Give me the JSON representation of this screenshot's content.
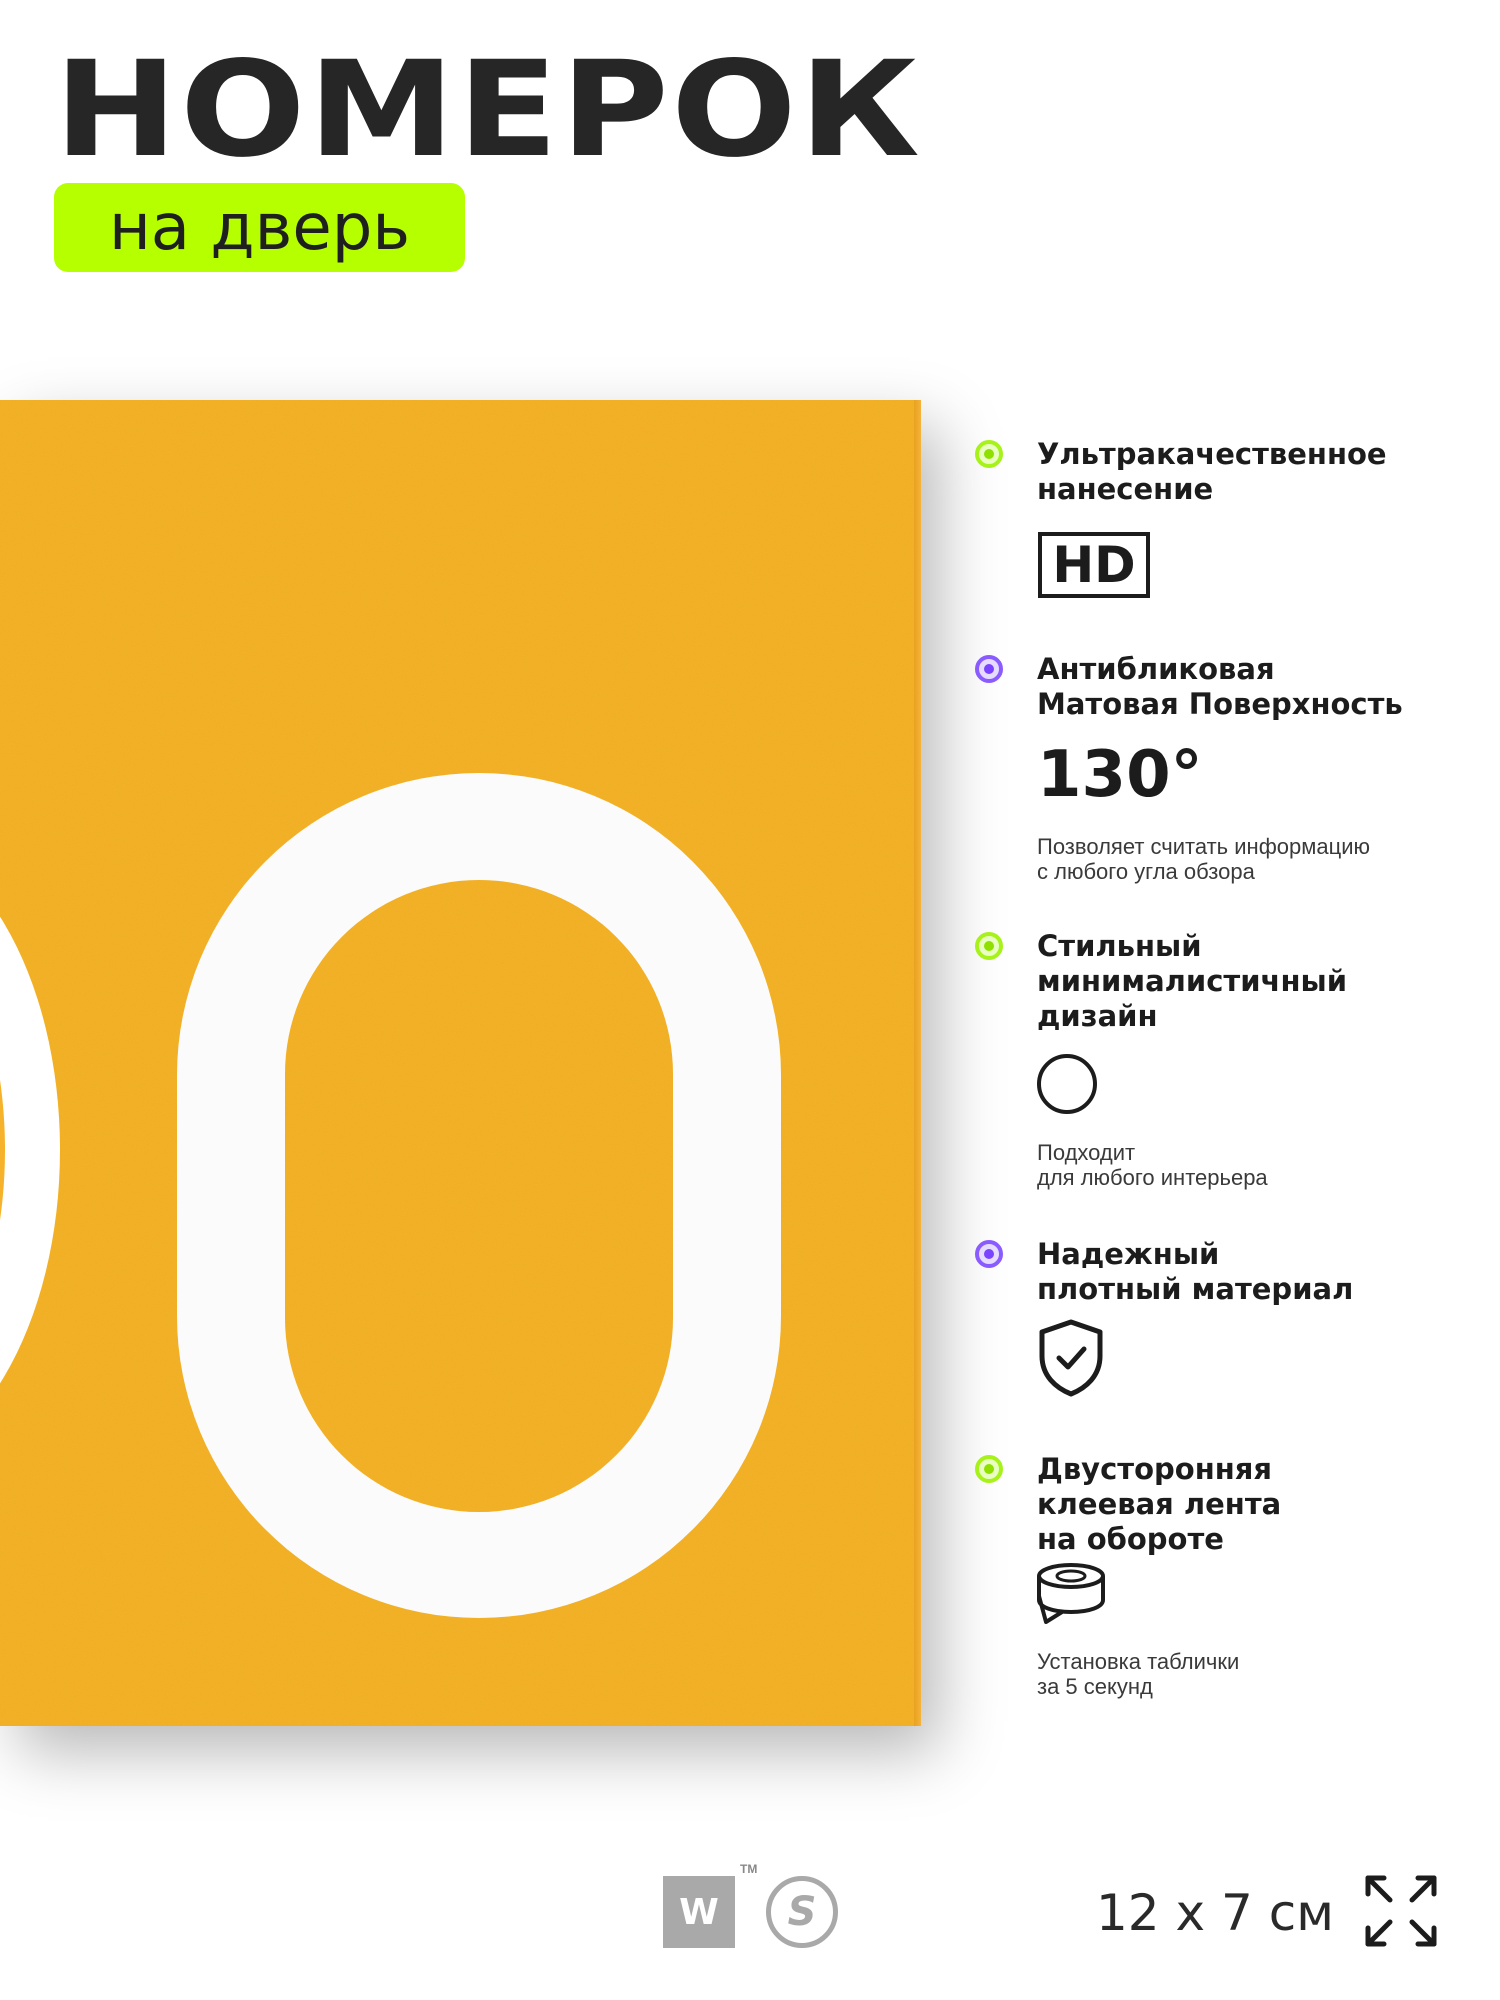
{
  "header": {
    "title": "НОМЕРОК",
    "subtitle": "на дверь"
  },
  "features": [
    {
      "title_lines": [
        "Ультракачественное",
        "нанесение"
      ],
      "badge": "HD",
      "bullet": "green"
    },
    {
      "title_lines": [
        "Антибликовая",
        "Матовая Поверхность"
      ],
      "value": "130°",
      "note_lines": [
        "Позволяет считать информацию",
        "с любого угла обзора"
      ],
      "bullet": "purple"
    },
    {
      "title_lines": [
        "Стильный",
        "минималистичный",
        "дизайн"
      ],
      "icon": "circle-icon",
      "note_lines": [
        "Подходит",
        "для любого интерьера"
      ],
      "bullet": "green"
    },
    {
      "title_lines": [
        "Надежный",
        "плотный материал"
      ],
      "icon": "shield-check-icon",
      "bullet": "purple"
    },
    {
      "title_lines": [
        "Двусторонняя",
        "клеевая лента",
        "на обороте"
      ],
      "icon": "tape-roll-icon",
      "note_lines": [
        "Установка таблички",
        "за 5 секунд"
      ],
      "bullet": "green"
    }
  ],
  "footer": {
    "brand_w": "W",
    "brand_tm": "TM",
    "brand_s": "S",
    "size_label": "12 х 7 см",
    "expand_icon": "expand-arrows-icon"
  },
  "colors": {
    "plate": "#f7b22b",
    "accent_green": "#b6ff00",
    "accent_purple": "#7a43ff",
    "text_dark": "#1c1c1c"
  }
}
